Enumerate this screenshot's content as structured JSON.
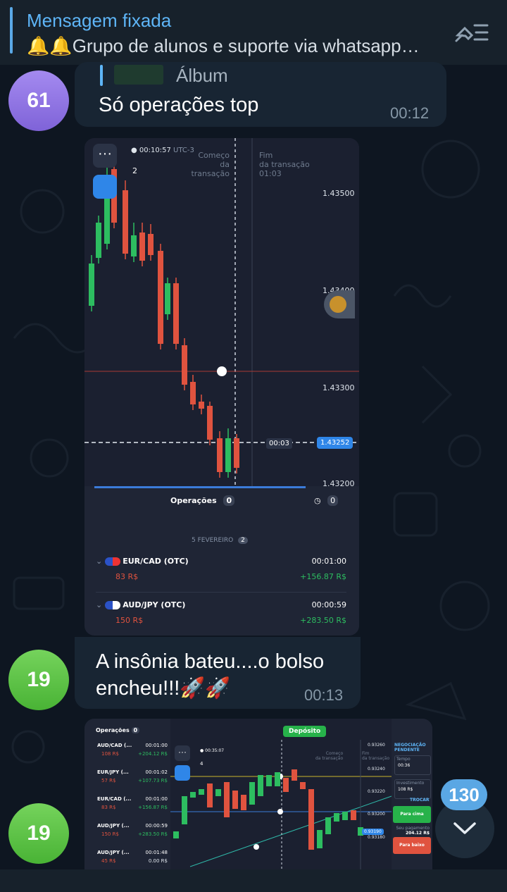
{
  "pinned": {
    "title": "Mensagem fixada",
    "text": "🔔🔔Grupo de alunos e suporte via whatsapp…"
  },
  "messages": [
    {
      "avatar": "61",
      "reply_label": "Álbum",
      "text": "Só operações top",
      "time": "00:12"
    },
    {
      "avatar": "19",
      "text_line1": "A insônia bateu....o bolso",
      "text_line2": "encheu!!!🚀🚀",
      "time": "00:13"
    },
    {
      "avatar": "19"
    }
  ],
  "screenshot1": {
    "clock": "00:10:57",
    "tz": "UTC-3",
    "counter": "2",
    "start_label_1": "Começo",
    "start_label_2": "da transação",
    "end_label_1": "Fim",
    "end_label_2": "da transação",
    "end_time": "01:03",
    "prices": [
      "1.43500",
      "1.43400",
      "1.43300",
      "1.43200"
    ],
    "countdown": "00:03",
    "current_price": "1.43252",
    "ops_title": "Operações",
    "ops_count": "0",
    "history_count": "0",
    "date_label": "5 FEVEREIRO",
    "date_count": "2",
    "trades": [
      {
        "pair": "EUR/CAD (OTC)",
        "duration": "00:01:00",
        "amount": "83 R$",
        "profit": "+156.87 R$"
      },
      {
        "pair": "AUD/JPY (OTC)",
        "duration": "00:00:59",
        "amount": "150 R$",
        "profit": "+283.50 R$"
      }
    ]
  },
  "screenshot2": {
    "ops_title": "Operações",
    "ops_count": "0",
    "deposit": "Depósito",
    "clock": "00:35:07",
    "counter": "4",
    "start_1": "Começo",
    "start_2": "da transação",
    "end_1": "Fim",
    "end_2": "da transação",
    "prices": [
      "0.93260",
      "0.93240",
      "0.93220",
      "0.93200",
      "0.93180"
    ],
    "price_tag": "0.93190",
    "pending_1": "NEGOCIAÇÃO",
    "pending_2": "PENDENTE",
    "tempo_label": "Tempo",
    "tempo_value": "00:36",
    "invest_label": "Investimento",
    "invest_value": "108 R$",
    "trocar": "TROCAR",
    "up_button": "Para cima",
    "payout_label": "Seu pagamento",
    "payout_value": "204.12 R$",
    "down_button": "Para baixo",
    "trades": [
      {
        "pair": "AUD/CAD (...",
        "dur": "00:01:00",
        "amt": "108 R$",
        "profit": "+204.12 R$"
      },
      {
        "pair": "EUR/JPY (...",
        "dur": "00:01:02",
        "amt": "57 R$",
        "profit": "+107.73 R$"
      },
      {
        "pair": "EUR/CAD (...",
        "dur": "00:01:00",
        "amt": "83 R$",
        "profit": "+156.87 R$"
      },
      {
        "pair": "AUD/JPY (...",
        "dur": "00:00:59",
        "amt": "150 R$",
        "profit": "+283.50 R$"
      },
      {
        "pair": "AUD/JPY (...",
        "dur": "00:01:48",
        "amt": "45 R$",
        "profit": "0.00 R$"
      }
    ]
  },
  "unread_badge": "130",
  "colors": {
    "background": "#0e1621",
    "bubble": "#182533",
    "accent": "#5eb5f7",
    "candle_up": "#2dbd60",
    "candle_down": "#e0533f"
  }
}
